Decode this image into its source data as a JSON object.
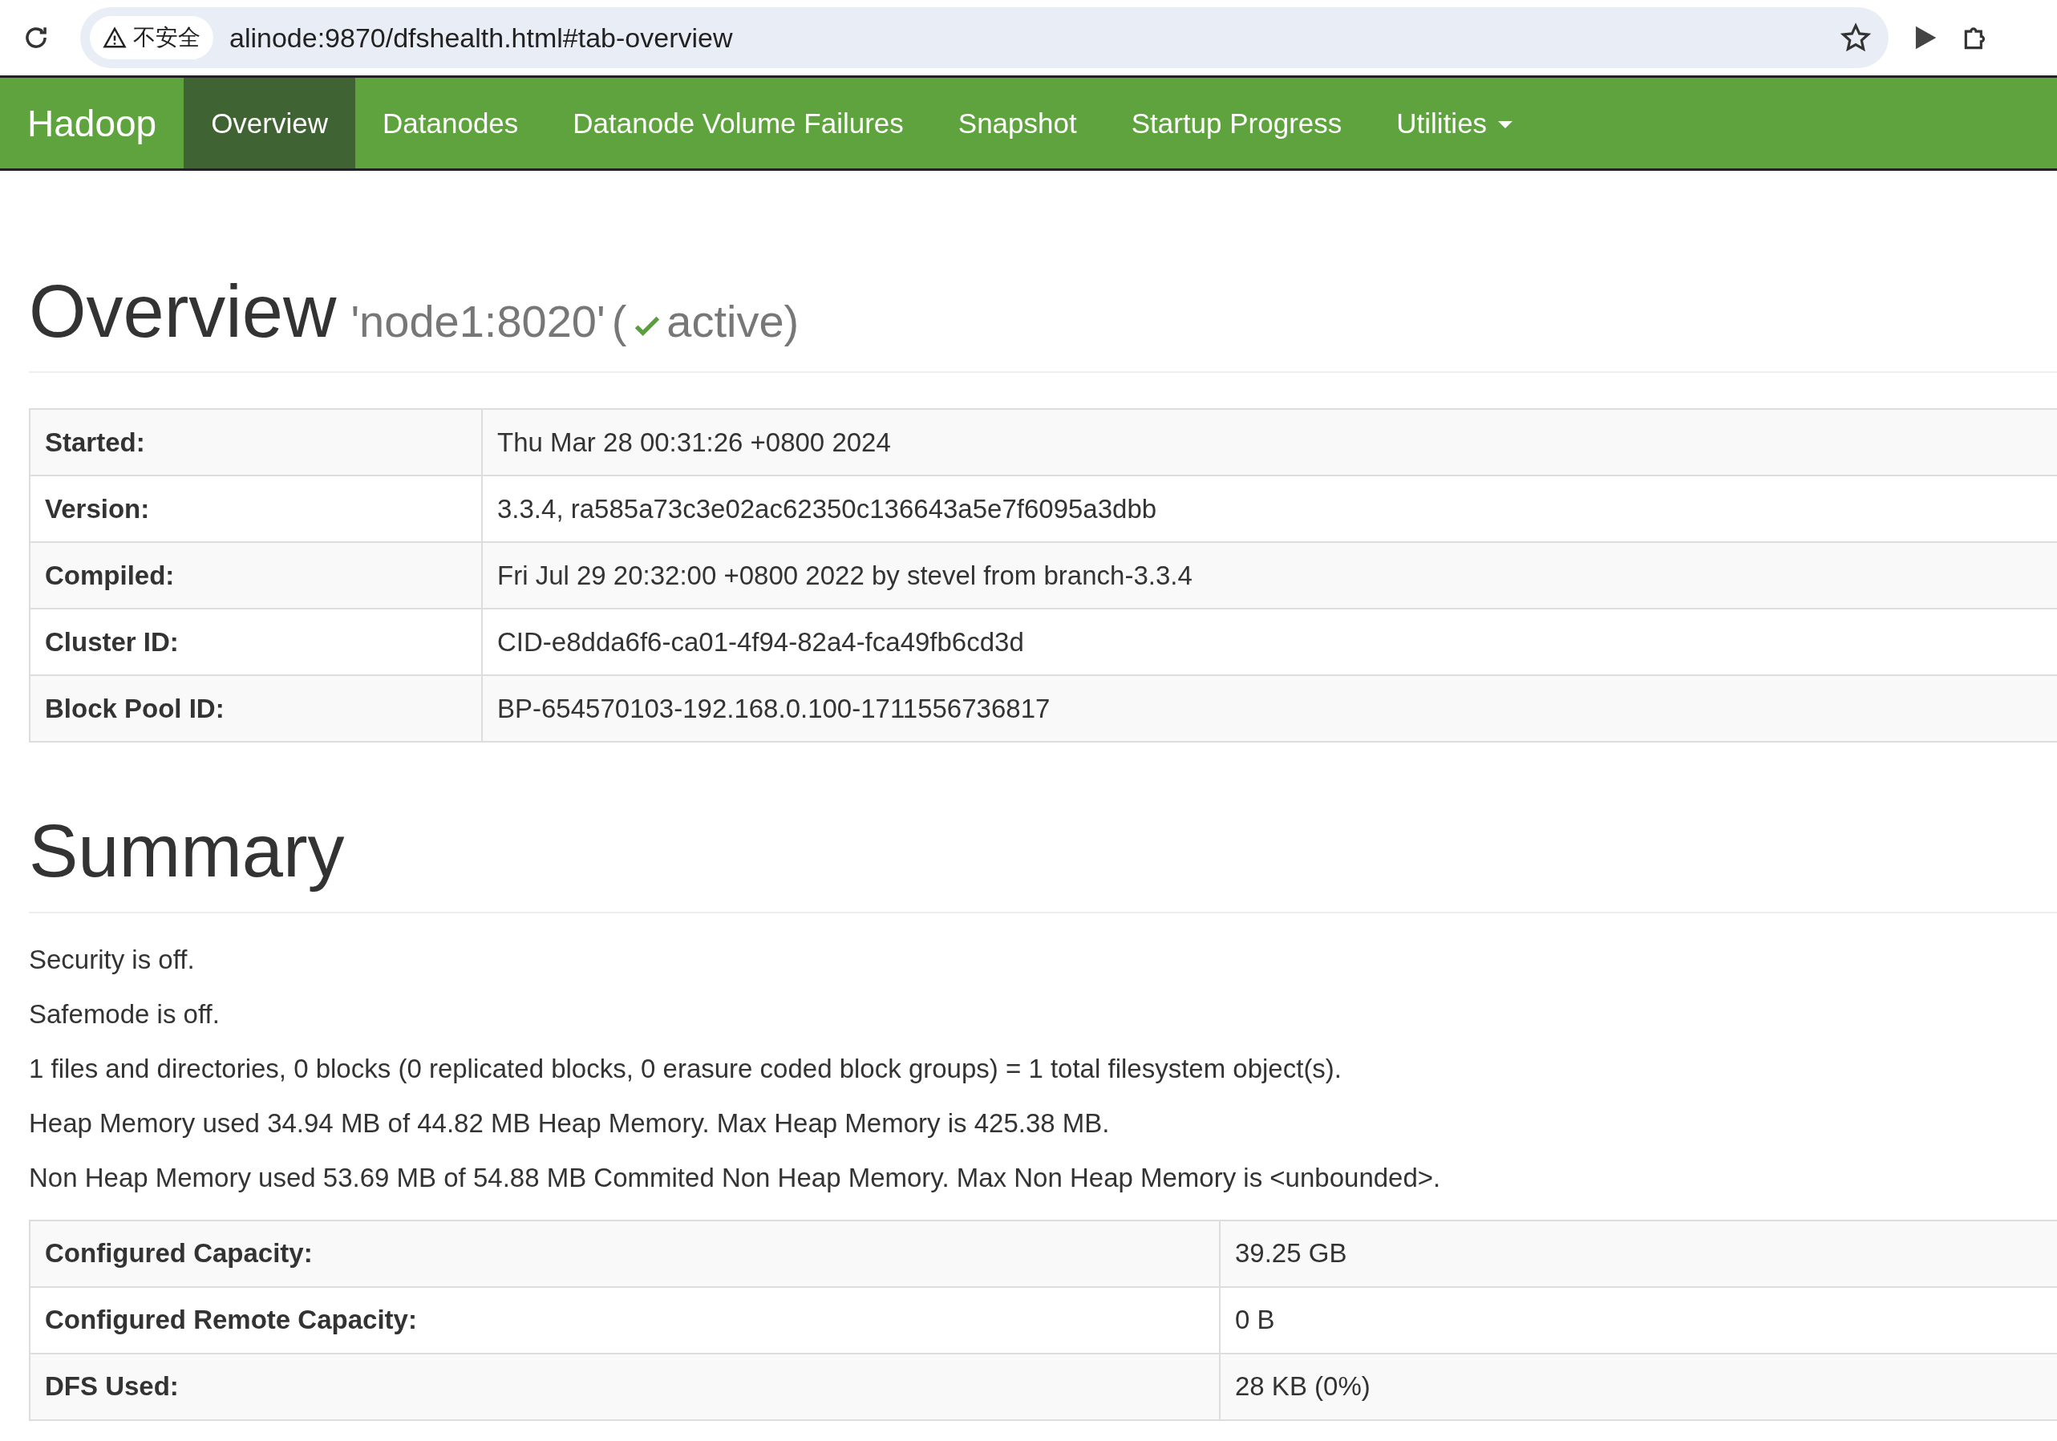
{
  "browser": {
    "security_label": "不安全",
    "url": "alinode:9870/dfshealth.html#tab-overview"
  },
  "navbar": {
    "brand": "Hadoop",
    "items": [
      {
        "label": "Overview",
        "selected": true,
        "kind": "link"
      },
      {
        "label": "Datanodes",
        "selected": false,
        "kind": "link"
      },
      {
        "label": "Datanode Volume Failures",
        "selected": false,
        "kind": "link"
      },
      {
        "label": "Snapshot",
        "selected": false,
        "kind": "link"
      },
      {
        "label": "Startup Progress",
        "selected": false,
        "kind": "link"
      },
      {
        "label": "Utilities",
        "selected": false,
        "kind": "dropdown"
      }
    ]
  },
  "overview": {
    "title": "Overview",
    "node": "'node1:8020'",
    "status_open": "(",
    "status": "active)",
    "active": true
  },
  "info_table": [
    {
      "label": "Started:",
      "value": "Thu Mar 28 00:31:26 +0800 2024"
    },
    {
      "label": "Version:",
      "value": "3.3.4, ra585a73c3e02ac62350c136643a5e7f6095a3dbb"
    },
    {
      "label": "Compiled:",
      "value": "Fri Jul 29 20:32:00 +0800 2022 by stevel from branch-3.3.4"
    },
    {
      "label": "Cluster ID:",
      "value": "CID-e8dda6f6-ca01-4f94-82a4-fca49fb6cd3d"
    },
    {
      "label": "Block Pool ID:",
      "value": "BP-654570103-192.168.0.100-1711556736817"
    }
  ],
  "summary": {
    "title": "Summary",
    "lines": [
      "Security is off.",
      "Safemode is off.",
      "1 files and directories, 0 blocks (0 replicated blocks, 0 erasure coded block groups) = 1 total filesystem object(s).",
      "Heap Memory used 34.94 MB of 44.82 MB Heap Memory. Max Heap Memory is 425.38 MB.",
      "Non Heap Memory used 53.69 MB of 54.88 MB Commited Non Heap Memory. Max Non Heap Memory is <unbounded>."
    ],
    "capacity_table": [
      {
        "label": "Configured Capacity:",
        "value": "39.25 GB"
      },
      {
        "label": "Configured Remote Capacity:",
        "value": "0 B"
      },
      {
        "label": "DFS Used:",
        "value": "28 KB (0%)"
      }
    ]
  }
}
